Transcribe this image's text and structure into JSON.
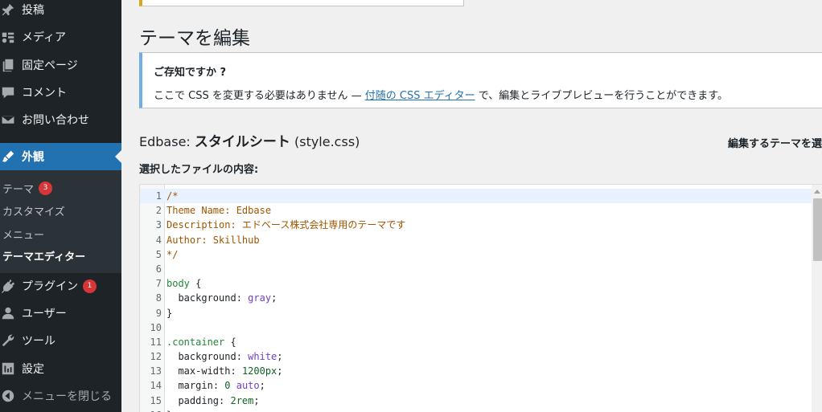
{
  "sidebar": {
    "items": [
      {
        "label": "投稿",
        "icon": "pin-icon"
      },
      {
        "label": "メディア",
        "icon": "media-icon"
      },
      {
        "label": "固定ページ",
        "icon": "pages-icon"
      },
      {
        "label": "コメント",
        "icon": "comment-icon"
      },
      {
        "label": "お問い合わせ",
        "icon": "mail-icon"
      },
      {
        "label": "外観",
        "icon": "brush-icon"
      },
      {
        "label": "プラグイン",
        "icon": "plugin-icon",
        "badge": "1"
      },
      {
        "label": "ユーザー",
        "icon": "user-icon"
      },
      {
        "label": "ツール",
        "icon": "wrench-icon"
      },
      {
        "label": "設定",
        "icon": "settings-icon"
      },
      {
        "label": "メニューを閉じる",
        "icon": "collapse-icon"
      }
    ],
    "submenu": [
      {
        "label": "テーマ",
        "badge": "3"
      },
      {
        "label": "カスタマイズ"
      },
      {
        "label": "メニュー"
      },
      {
        "label": "テーマエディター"
      }
    ]
  },
  "page": {
    "title": "テーマを編集"
  },
  "notice": {
    "title": "ご存知ですか ?",
    "text_before": "ここで CSS を変更する必要はありません — ",
    "link": "付随の CSS エディター",
    "text_after": " で、編集とライブプレビューを行うことができます。"
  },
  "file": {
    "theme": "Edbase:",
    "name": "スタイルシート",
    "filename": "(style.css)",
    "select_label": "編集するテーマを選",
    "content_label": "選択したファイルの内容:"
  },
  "code_lines": [
    "/*",
    "Theme Name: Edbase",
    "Description: エドベース株式会社専用のテーマです",
    "Author: Skillhub",
    "*/",
    "",
    "body {",
    "  background: gray;",
    "}",
    "",
    ".container {",
    "  background: white;",
    "  max-width: 1200px;",
    "  margin: 0 auto;",
    "  padding: 2rem;",
    "}"
  ],
  "colors": {
    "sidebar_bg": "#1d2327",
    "accent": "#2271b1",
    "badge": "#d63638"
  }
}
